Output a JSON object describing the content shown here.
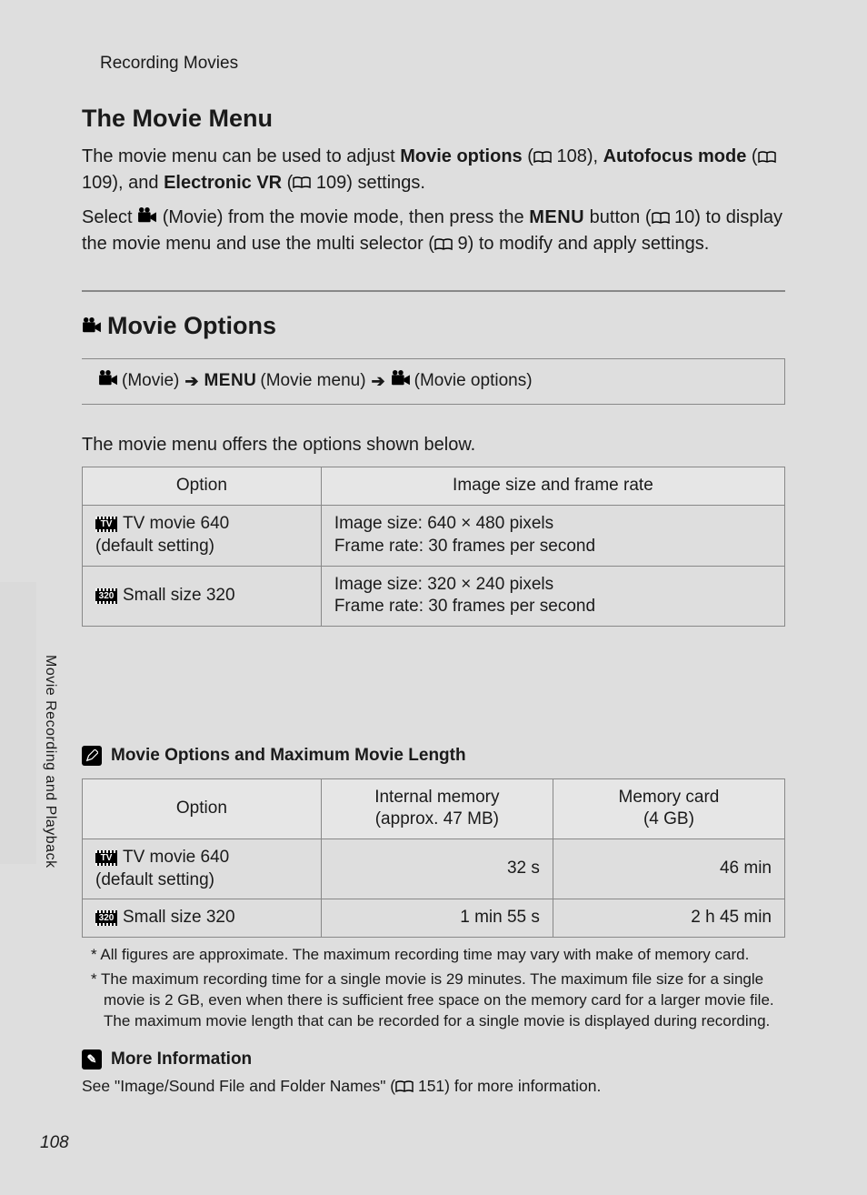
{
  "header": {
    "section": "Recording Movies"
  },
  "h1": "The Movie Menu",
  "intro": {
    "p1_a": "The movie menu can be used to adjust ",
    "p1_b": "Movie options",
    "p1_c": " (",
    "ref1": " 108), ",
    "p1_d": "Autofocus mode",
    "p1_e": " (",
    "ref2": " 109), and ",
    "p1_f": "Electronic VR",
    "p1_g": " (",
    "ref3": " 109) settings.",
    "p2_a": "Select ",
    "p2_b": " (Movie) from the movie mode, then press the ",
    "p2_menu": "MENU",
    "p2_c": " button (",
    "ref4": " 10) to display the movie menu and use the multi selector (",
    "ref5": " 9) to modify and apply settings."
  },
  "h2": "Movie Options",
  "breadcrumb": {
    "a": " (Movie) ",
    "menu": "MENU",
    "b": " (Movie menu) ",
    "c": " (Movie options)"
  },
  "sub": "The movie menu offers the options shown below.",
  "table1": {
    "headers": [
      "Option",
      "Image size and frame rate"
    ],
    "rows": [
      {
        "badge": "TV",
        "label": "TV movie 640",
        "sublabel": "(default setting)",
        "desc_a": "Image size: 640 × 480 pixels",
        "desc_b": "Frame rate: 30 frames per second"
      },
      {
        "badge": "320",
        "label": "Small size 320",
        "sublabel": "",
        "desc_a": "Image size: 320 × 240 pixels",
        "desc_b": "Frame rate: 30 frames per second"
      }
    ]
  },
  "callout1": "Movie Options and Maximum Movie Length",
  "table2": {
    "headers": [
      "Option",
      "Internal memory\n(approx. 47 MB)",
      "Memory card\n(4 GB)"
    ],
    "rows": [
      {
        "badge": "TV",
        "label": "TV movie 640",
        "sublabel": "(default setting)",
        "c1": "32 s",
        "c2": "46 min"
      },
      {
        "badge": "320",
        "label": "Small size 320",
        "sublabel": "",
        "c1": "1 min 55 s",
        "c2": "2 h 45 min"
      }
    ]
  },
  "footnotes": [
    "* All figures are approximate. The maximum recording time may vary with make of memory card.",
    "* The maximum recording time for a single movie is 29 minutes. The maximum file size for a single movie is 2 GB, even when there is sufficient free space on the memory card for a larger movie file. The maximum movie length that can be recorded for a single movie is displayed during recording."
  ],
  "more_heading": "More Information",
  "more_text_a": "See \"Image/Sound File and Folder Names\" (",
  "more_text_b": " 151) for more information.",
  "side_label": "Movie Recording and Playback",
  "page_number": "108"
}
